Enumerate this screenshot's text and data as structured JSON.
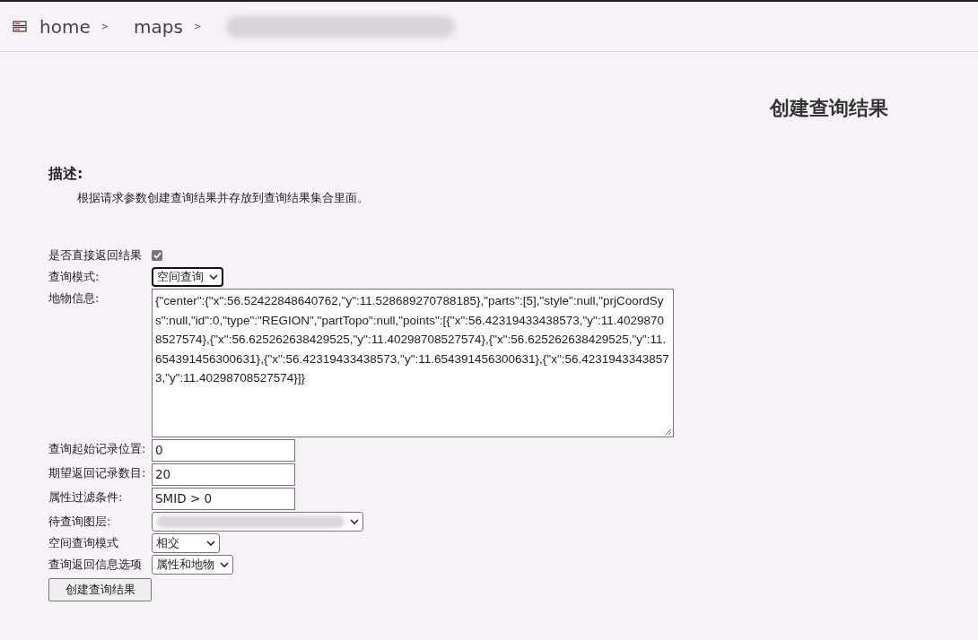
{
  "breadcrumb": [
    {
      "label": "home",
      "separator": ">"
    },
    {
      "label": "maps",
      "separator": ">"
    },
    {
      "kind": "redacted"
    }
  ],
  "title": "创建查询结果",
  "description": {
    "heading": "描述:",
    "text": "根据请求参数创建查询结果并存放到查询结果集合里面。"
  },
  "fields": [
    {
      "kind": "checkbox",
      "label": "是否直接返回结果",
      "checked": true
    },
    {
      "kind": "select",
      "label": "查询模式:",
      "value": "空间查询",
      "focused": true
    },
    {
      "kind": "textarea",
      "label": "地物信息:",
      "value": "{\"center\":{\"x\":56.52422848640762,\"y\":11.528689270788185},\"parts\":[5],\"style\":null,\"prjCoordSys\":null,\"id\":0,\"type\":\"REGION\",\"partTopo\":null,\"points\":[{\"x\":56.42319433438573,\"y\":11.40298708527574},{\"x\":56.625262638429525,\"y\":11.40298708527574},{\"x\":56.625262638429525,\"y\":11.654391456300631},{\"x\":56.42319433438573,\"y\":11.654391456300631},{\"x\":56.42319433438573,\"y\":11.40298708527574}]}"
    },
    {
      "kind": "input",
      "label": "查询起始记录位置:",
      "value": "0"
    },
    {
      "kind": "input",
      "label": "期望返回记录数目:",
      "value": "20"
    },
    {
      "kind": "input",
      "label": "属性过滤条件:",
      "value": "SMID > 0"
    },
    {
      "kind": "select",
      "label": "待查询图层:",
      "redacted": true,
      "focused": false
    },
    {
      "kind": "select",
      "label": "空间查询模式",
      "value": "相交",
      "focused": false
    },
    {
      "kind": "select",
      "label": "查询返回信息选项",
      "value": "属性和地物",
      "focused": false
    }
  ],
  "submit": "创建查询结果"
}
